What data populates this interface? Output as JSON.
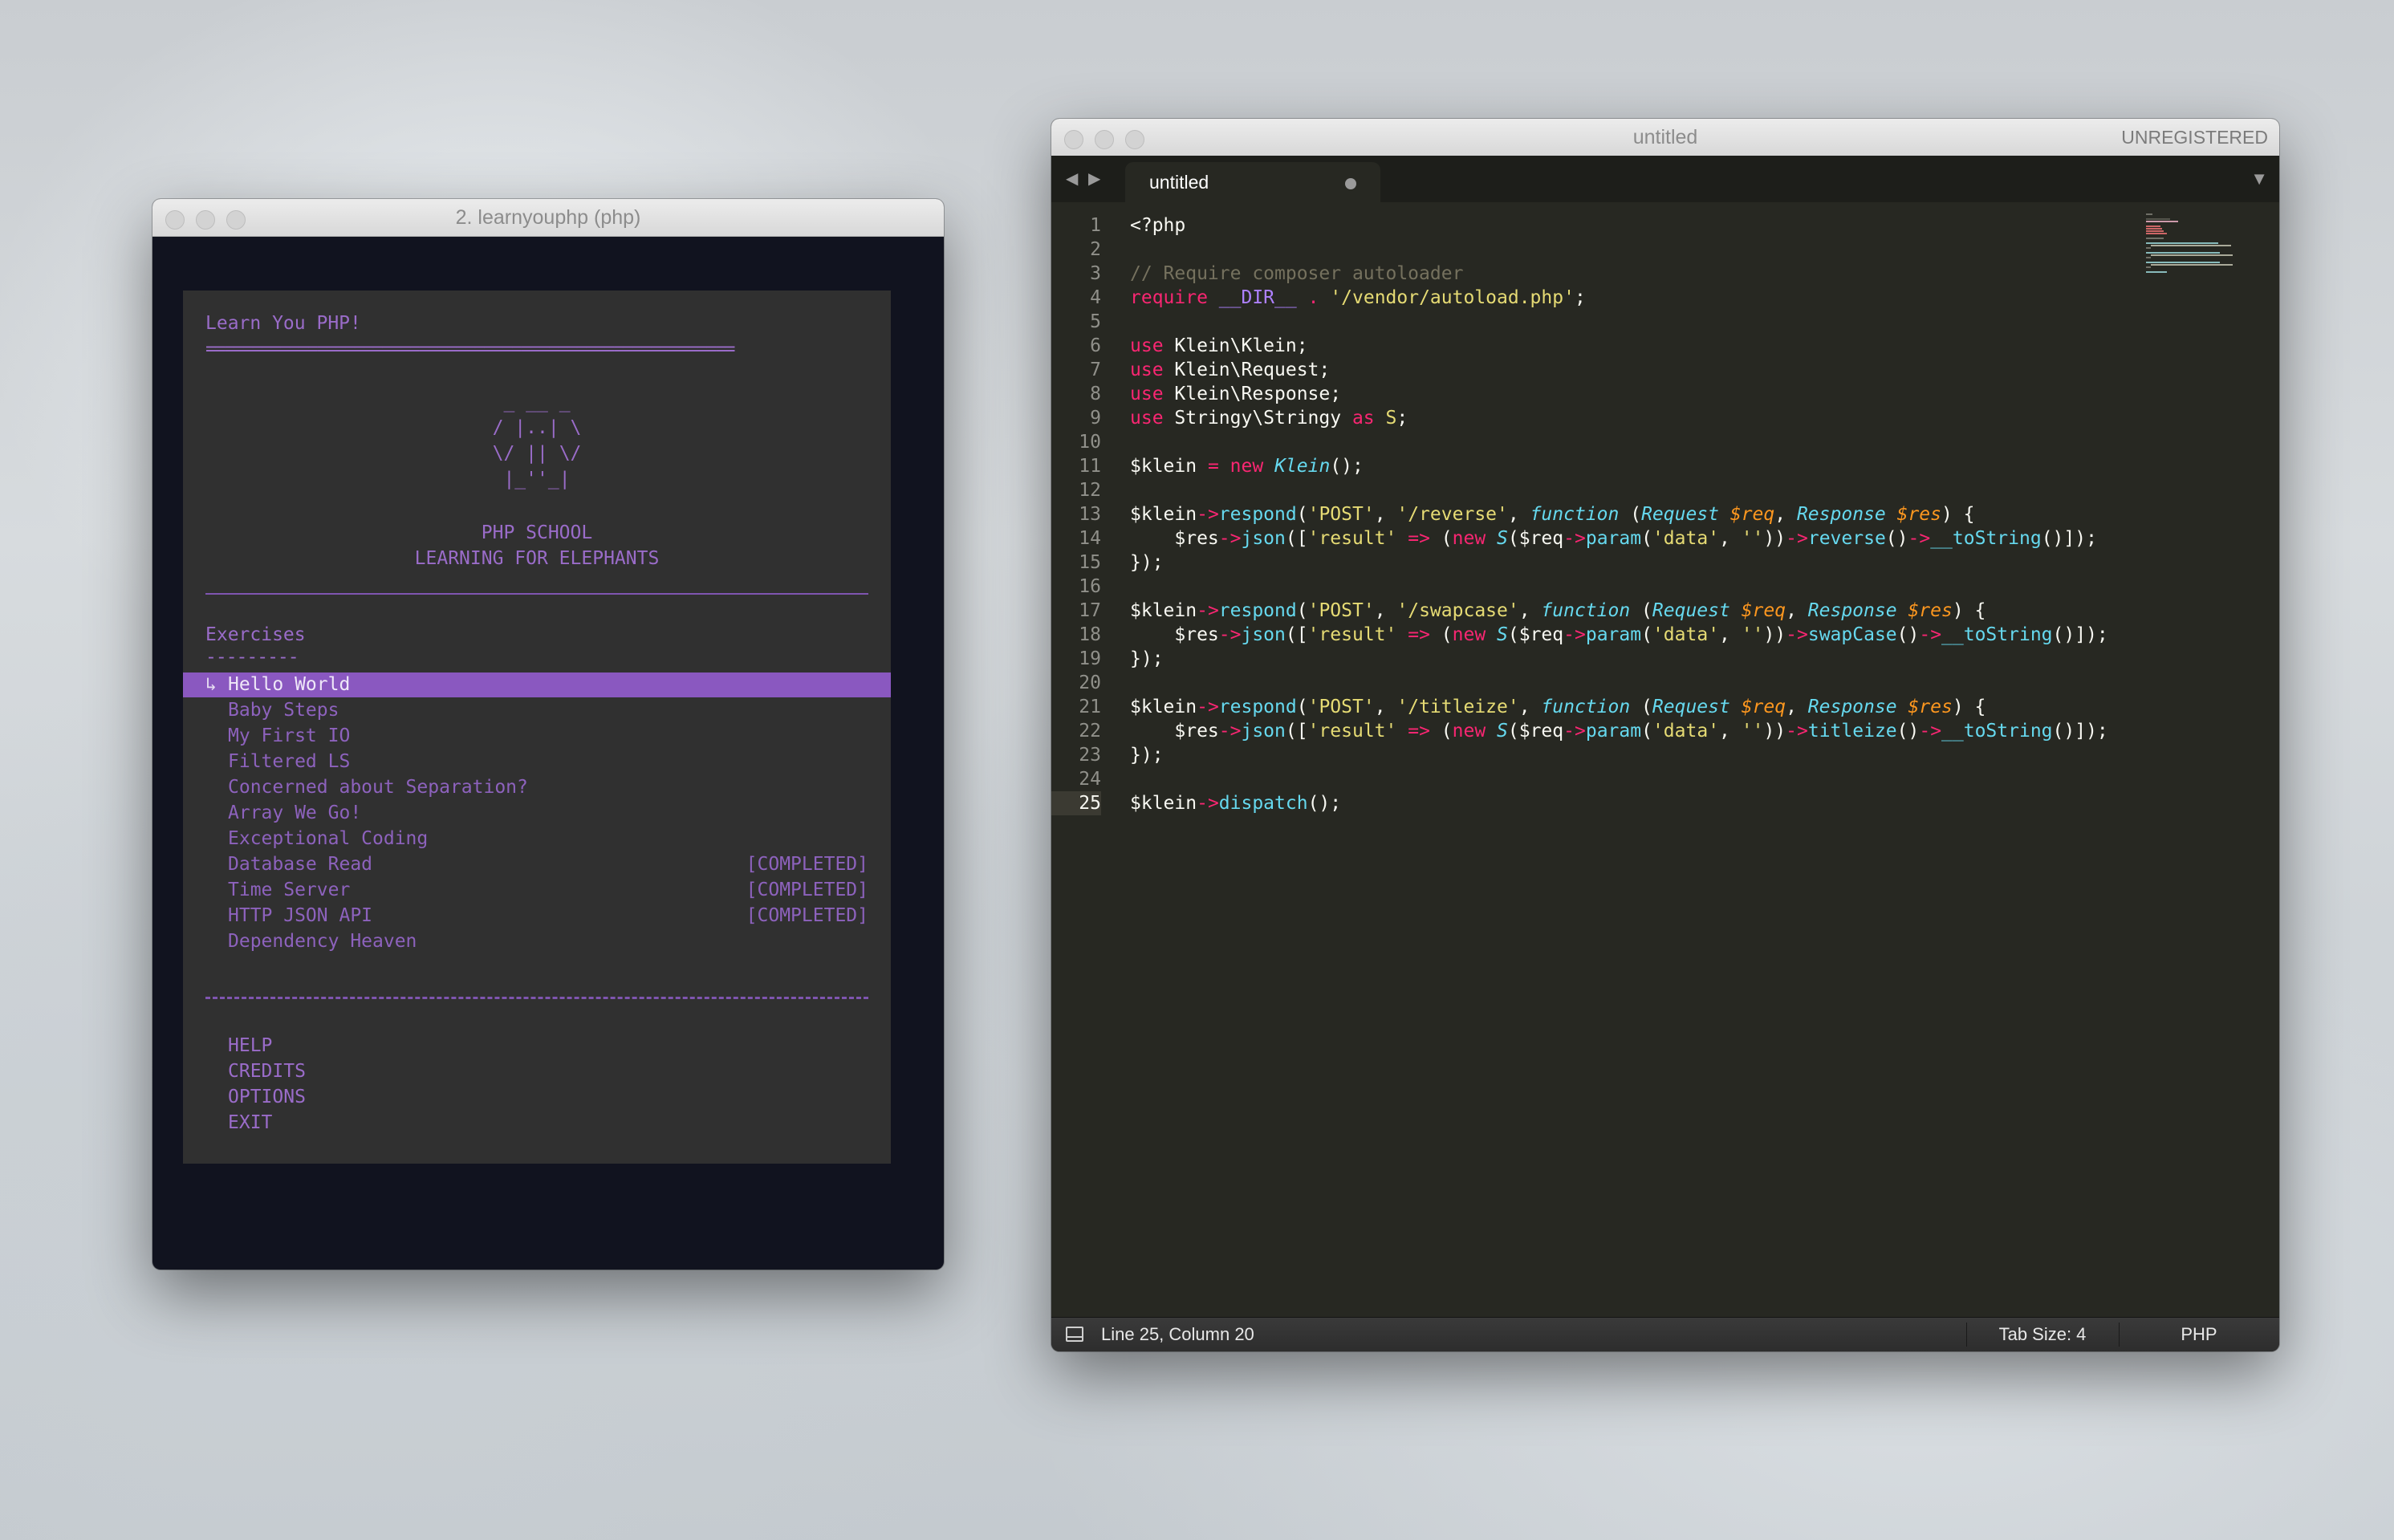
{
  "terminal": {
    "window_title": "2. learnyouphp (php)",
    "header": "Learn You PHP!",
    "rule": "=========================================================",
    "logo_lines": [
      " _ __ _ ",
      "/ |..| \\",
      "\\/ || \\/",
      " |_''_| "
    ],
    "school": "PHP SCHOOL",
    "tagline": "LEARNING FOR ELEPHANTS",
    "exercises_heading": "Exercises",
    "exercises_underline": "---------",
    "selected_marker": "↳",
    "exercises": [
      {
        "name": "Hello World",
        "status": ""
      },
      {
        "name": "Baby Steps",
        "status": ""
      },
      {
        "name": "My First IO",
        "status": ""
      },
      {
        "name": "Filtered LS",
        "status": ""
      },
      {
        "name": "Concerned about Separation?",
        "status": ""
      },
      {
        "name": "Array We Go!",
        "status": ""
      },
      {
        "name": "Exceptional Coding",
        "status": ""
      },
      {
        "name": "Database Read",
        "status": "[COMPLETED]"
      },
      {
        "name": "Time Server",
        "status": "[COMPLETED]"
      },
      {
        "name": "HTTP JSON API",
        "status": "[COMPLETED]"
      },
      {
        "name": "Dependency Heaven",
        "status": ""
      }
    ],
    "menu": [
      "HELP",
      "CREDITS",
      "OPTIONS",
      "EXIT"
    ]
  },
  "editor": {
    "window_title": "untitled",
    "license": "UNREGISTERED",
    "tab_label": "untitled",
    "current_line": 25,
    "status": {
      "position": "Line 25, Column 20",
      "tab_size": "Tab Size: 4",
      "syntax": "PHP"
    },
    "code": [
      [
        [
          "<?php",
          ""
        ]
      ],
      [],
      [
        [
          "// Require composer autoloader",
          "cmt"
        ]
      ],
      [
        [
          "require",
          "kw"
        ],
        [
          " ",
          ""
        ],
        [
          "__DIR__",
          "cst"
        ],
        [
          " ",
          ""
        ],
        [
          ".",
          "kw"
        ],
        [
          " ",
          ""
        ],
        [
          "'/vendor/autoload.php'",
          "str"
        ],
        [
          ";",
          ""
        ]
      ],
      [],
      [
        [
          "use",
          "kw"
        ],
        [
          " Klein\\Klein;",
          ""
        ]
      ],
      [
        [
          "use",
          "kw"
        ],
        [
          " Klein\\Request;",
          ""
        ]
      ],
      [
        [
          "use",
          "kw"
        ],
        [
          " Klein\\Response;",
          ""
        ]
      ],
      [
        [
          "use",
          "kw"
        ],
        [
          " Stringy\\Stringy ",
          ""
        ],
        [
          "as",
          "kw"
        ],
        [
          " ",
          ""
        ],
        [
          "S",
          "str"
        ],
        [
          ";",
          ""
        ]
      ],
      [],
      [
        [
          "$klein ",
          ""
        ],
        [
          "=",
          "kw"
        ],
        [
          " ",
          ""
        ],
        [
          "new",
          "kw"
        ],
        [
          " ",
          ""
        ],
        [
          "Klein",
          "cls"
        ],
        [
          "();",
          ""
        ]
      ],
      [],
      [
        [
          "$klein",
          ""
        ],
        [
          "->",
          "kw"
        ],
        [
          "respond",
          "fn"
        ],
        [
          "(",
          ""
        ],
        [
          "'POST'",
          "str"
        ],
        [
          ", ",
          ""
        ],
        [
          "'/reverse'",
          "str"
        ],
        [
          ", ",
          ""
        ],
        [
          "function",
          "cls"
        ],
        [
          " (",
          ""
        ],
        [
          "Request",
          "cls"
        ],
        [
          " ",
          ""
        ],
        [
          "$req",
          "prm"
        ],
        [
          ", ",
          ""
        ],
        [
          "Response",
          "cls"
        ],
        [
          " ",
          ""
        ],
        [
          "$res",
          "prm"
        ],
        [
          ") {",
          ""
        ]
      ],
      [
        [
          "    $res",
          ""
        ],
        [
          "->",
          "kw"
        ],
        [
          "json",
          "fn"
        ],
        [
          "([",
          ""
        ],
        [
          "'result'",
          "str"
        ],
        [
          " ",
          ""
        ],
        [
          "=>",
          "kw"
        ],
        [
          " (",
          ""
        ],
        [
          "new",
          "kw"
        ],
        [
          " ",
          ""
        ],
        [
          "S",
          "cls"
        ],
        [
          "($req",
          ""
        ],
        [
          "->",
          "kw"
        ],
        [
          "param",
          "fn"
        ],
        [
          "(",
          ""
        ],
        [
          "'data'",
          "str"
        ],
        [
          ", ",
          ""
        ],
        [
          "''",
          "str"
        ],
        [
          "))",
          ""
        ],
        [
          "->",
          "kw"
        ],
        [
          "reverse",
          "fn"
        ],
        [
          "()",
          ""
        ],
        [
          "->",
          "kw"
        ],
        [
          "__toString",
          "fn"
        ],
        [
          "()]);",
          ""
        ]
      ],
      [
        [
          "});",
          ""
        ]
      ],
      [],
      [
        [
          "$klein",
          ""
        ],
        [
          "->",
          "kw"
        ],
        [
          "respond",
          "fn"
        ],
        [
          "(",
          ""
        ],
        [
          "'POST'",
          "str"
        ],
        [
          ", ",
          ""
        ],
        [
          "'/swapcase'",
          "str"
        ],
        [
          ", ",
          ""
        ],
        [
          "function",
          "cls"
        ],
        [
          " (",
          ""
        ],
        [
          "Request",
          "cls"
        ],
        [
          " ",
          ""
        ],
        [
          "$req",
          "prm"
        ],
        [
          ", ",
          ""
        ],
        [
          "Response",
          "cls"
        ],
        [
          " ",
          ""
        ],
        [
          "$res",
          "prm"
        ],
        [
          ") {",
          ""
        ]
      ],
      [
        [
          "    $res",
          ""
        ],
        [
          "->",
          "kw"
        ],
        [
          "json",
          "fn"
        ],
        [
          "([",
          ""
        ],
        [
          "'result'",
          "str"
        ],
        [
          " ",
          ""
        ],
        [
          "=>",
          "kw"
        ],
        [
          " (",
          ""
        ],
        [
          "new",
          "kw"
        ],
        [
          " ",
          ""
        ],
        [
          "S",
          "cls"
        ],
        [
          "($req",
          ""
        ],
        [
          "->",
          "kw"
        ],
        [
          "param",
          "fn"
        ],
        [
          "(",
          ""
        ],
        [
          "'data'",
          "str"
        ],
        [
          ", ",
          ""
        ],
        [
          "''",
          "str"
        ],
        [
          "))",
          ""
        ],
        [
          "->",
          "kw"
        ],
        [
          "swapCase",
          "fn"
        ],
        [
          "()",
          ""
        ],
        [
          "->",
          "kw"
        ],
        [
          "__toString",
          "fn"
        ],
        [
          "()]);",
          ""
        ]
      ],
      [
        [
          "});",
          ""
        ]
      ],
      [],
      [
        [
          "$klein",
          ""
        ],
        [
          "->",
          "kw"
        ],
        [
          "respond",
          "fn"
        ],
        [
          "(",
          ""
        ],
        [
          "'POST'",
          "str"
        ],
        [
          ", ",
          ""
        ],
        [
          "'/titleize'",
          "str"
        ],
        [
          ", ",
          ""
        ],
        [
          "function",
          "cls"
        ],
        [
          " (",
          ""
        ],
        [
          "Request",
          "cls"
        ],
        [
          " ",
          ""
        ],
        [
          "$req",
          "prm"
        ],
        [
          ", ",
          ""
        ],
        [
          "Response",
          "cls"
        ],
        [
          " ",
          ""
        ],
        [
          "$res",
          "prm"
        ],
        [
          ") {",
          ""
        ]
      ],
      [
        [
          "    $res",
          ""
        ],
        [
          "->",
          "kw"
        ],
        [
          "json",
          "fn"
        ],
        [
          "([",
          ""
        ],
        [
          "'result'",
          "str"
        ],
        [
          " ",
          ""
        ],
        [
          "=>",
          "kw"
        ],
        [
          " (",
          ""
        ],
        [
          "new",
          "kw"
        ],
        [
          " ",
          ""
        ],
        [
          "S",
          "cls"
        ],
        [
          "($req",
          ""
        ],
        [
          "->",
          "kw"
        ],
        [
          "param",
          "fn"
        ],
        [
          "(",
          ""
        ],
        [
          "'data'",
          "str"
        ],
        [
          ", ",
          ""
        ],
        [
          "''",
          "str"
        ],
        [
          "))",
          ""
        ],
        [
          "->",
          "kw"
        ],
        [
          "titleize",
          "fn"
        ],
        [
          "()",
          ""
        ],
        [
          "->",
          "kw"
        ],
        [
          "__toString",
          "fn"
        ],
        [
          "()]);",
          ""
        ]
      ],
      [
        [
          "});",
          ""
        ]
      ],
      [],
      [
        [
          "$klein",
          ""
        ],
        [
          "->",
          "kw"
        ],
        [
          "dispatch",
          "fn"
        ],
        [
          "();",
          ""
        ]
      ]
    ]
  },
  "colors": {
    "terminal_text": "#9a6cc9",
    "terminal_selection": "#8a58c0",
    "editor_bg": "#272822",
    "keyword": "#f92672",
    "string": "#e6db74",
    "function": "#66d9ef",
    "parameter": "#fd971f",
    "comment": "#75715e"
  }
}
